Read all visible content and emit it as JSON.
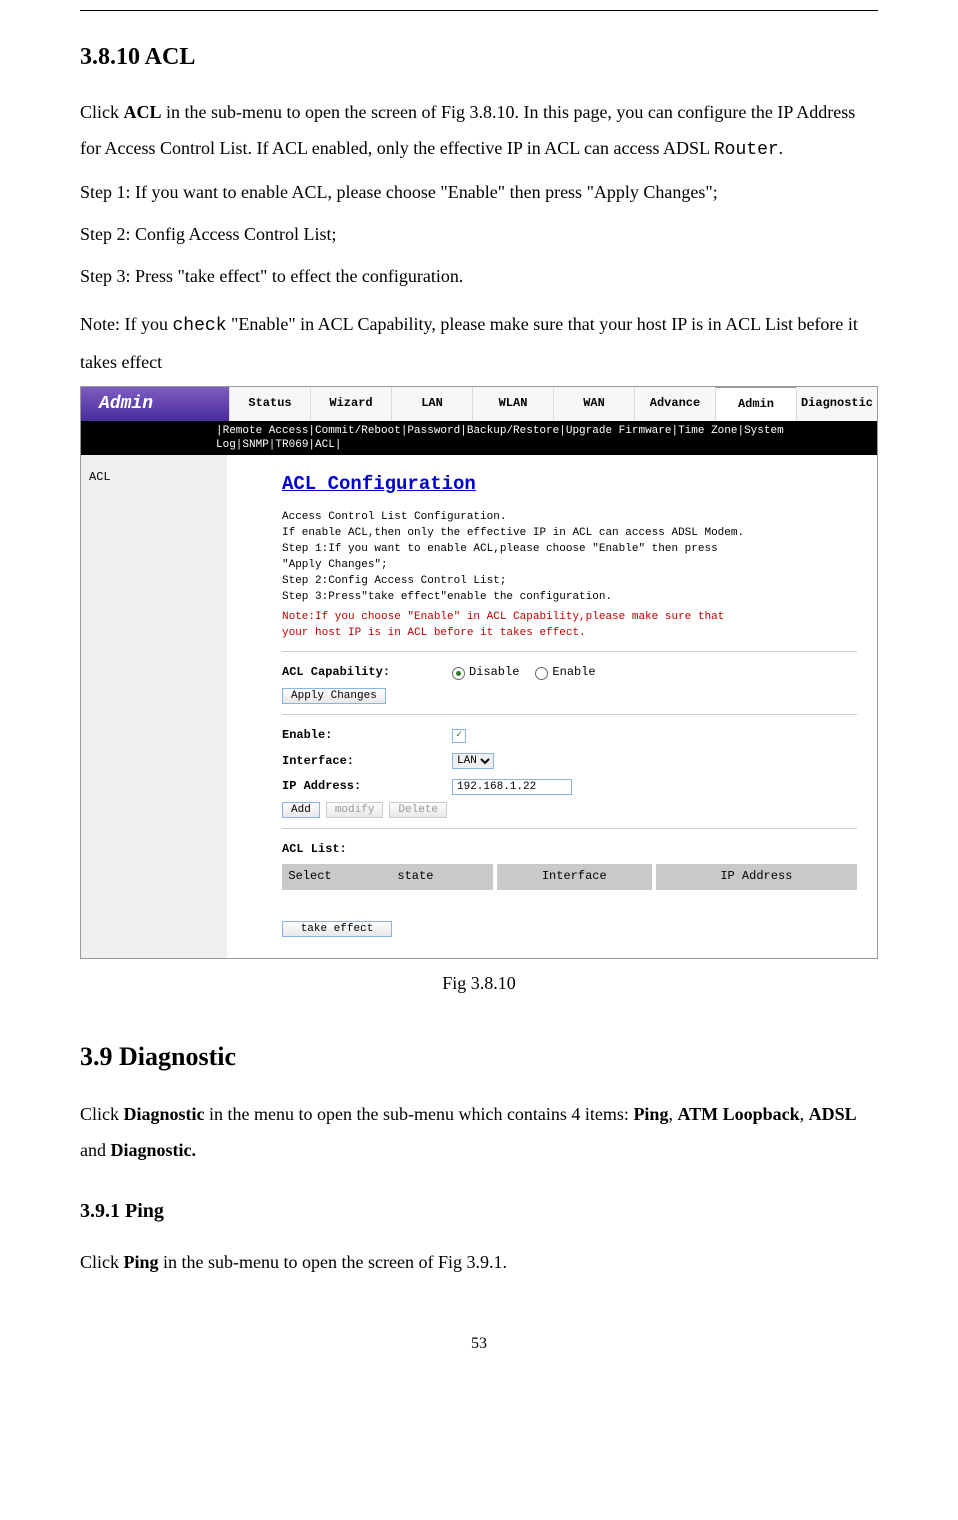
{
  "doc": {
    "section_acl": "3.8.10 ACL",
    "intro1_a": "Click ",
    "intro1_bold": "ACL",
    "intro1_b": " in the sub-menu to open the screen of Fig 3.8.10. In this page, you can configure the IP Address for Access Control List. If ACL enabled, only the effective IP in ACL can access ADSL ",
    "intro1_mono": "Router",
    "intro1_c": ".",
    "step1": "Step 1: If you want to enable ACL, please choose \"Enable\" then press \"Apply Changes\";",
    "step2": "Step 2: Config Access Control List;",
    "step3": "Step 3: Press \"take effect\" to effect the configuration.",
    "note_a": "Note: If you ",
    "note_mono": "check",
    "note_b": " \"Enable\" in ACL Capability, please make sure that your host IP is in ACL List before it takes effect",
    "fig_caption": "Fig 3.8.10",
    "section_diag": "3.9 Diagnostic",
    "diag_a": "Click ",
    "diag_bold1": "Diagnostic",
    "diag_b": " in the menu to open the sub-menu which contains 4 items: ",
    "diag_bold2": "Ping",
    "diag_c": ", ",
    "diag_bold3": "ATM Loopback",
    "diag_d": ", ",
    "diag_bold4": "ADSL",
    "diag_e": " and ",
    "diag_bold5": "Diagnostic.",
    "section_ping": "3.9.1 Ping",
    "ping_a": "Click ",
    "ping_bold": "Ping",
    "ping_b": " in the sub-menu to open the screen of Fig 3.9.1.",
    "page_number": "53"
  },
  "ss": {
    "brand": "Admin",
    "topnav": [
      "Status",
      "Wizard",
      "LAN",
      "WLAN",
      "WAN",
      "Advance",
      "Admin",
      "Diagnostic"
    ],
    "topnav_active": "Admin",
    "subnav": "|Remote Access|Commit/Reboot|Password|Backup/Restore|Upgrade Firmware|Time Zone|System Log|SNMP|TR069|ACL|",
    "side_item": "ACL",
    "panel_title": "ACL Configuration",
    "desc": "Access Control List Configuration.\nIf enable ACL,then only the effective IP in ACL can access ADSL Modem.\nStep 1:If you want to enable ACL,please choose \"Enable\" then press\n\"Apply Changes\";\nStep 2:Config Access Control List;\nStep 3:Press\"take effect\"enable the configuration.",
    "warn": "Note:If you choose \"Enable\" in ACL Capability,please make sure that\nyour host IP is in ACL before it takes effect.",
    "acl_cap_label": "ACL Capability:",
    "radio_disable": "Disable",
    "radio_enable": "Enable",
    "btn_apply": "Apply Changes",
    "lbl_enable": "Enable:",
    "lbl_interface": "Interface:",
    "lbl_ip": "IP Address:",
    "interface_value": "LAN",
    "ip_value": "192.168.1.22",
    "btn_add": "Add",
    "btn_modify": "modify",
    "btn_delete": "Delete",
    "acl_list_label": "ACL List:",
    "th_select": "Select",
    "th_state": "state",
    "th_interface": "Interface",
    "th_ip": "IP Address",
    "btn_take_effect": "take effect"
  }
}
